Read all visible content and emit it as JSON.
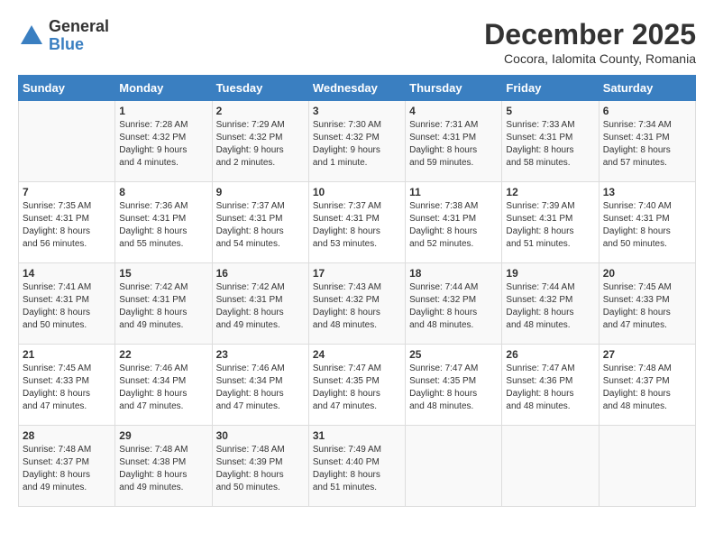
{
  "logo": {
    "general": "General",
    "blue": "Blue"
  },
  "title": "December 2025",
  "location": "Cocora, Ialomita County, Romania",
  "weekdays": [
    "Sunday",
    "Monday",
    "Tuesday",
    "Wednesday",
    "Thursday",
    "Friday",
    "Saturday"
  ],
  "weeks": [
    [
      {
        "day": "",
        "content": ""
      },
      {
        "day": "1",
        "content": "Sunrise: 7:28 AM\nSunset: 4:32 PM\nDaylight: 9 hours\nand 4 minutes."
      },
      {
        "day": "2",
        "content": "Sunrise: 7:29 AM\nSunset: 4:32 PM\nDaylight: 9 hours\nand 2 minutes."
      },
      {
        "day": "3",
        "content": "Sunrise: 7:30 AM\nSunset: 4:32 PM\nDaylight: 9 hours\nand 1 minute."
      },
      {
        "day": "4",
        "content": "Sunrise: 7:31 AM\nSunset: 4:31 PM\nDaylight: 8 hours\nand 59 minutes."
      },
      {
        "day": "5",
        "content": "Sunrise: 7:33 AM\nSunset: 4:31 PM\nDaylight: 8 hours\nand 58 minutes."
      },
      {
        "day": "6",
        "content": "Sunrise: 7:34 AM\nSunset: 4:31 PM\nDaylight: 8 hours\nand 57 minutes."
      }
    ],
    [
      {
        "day": "7",
        "content": "Sunrise: 7:35 AM\nSunset: 4:31 PM\nDaylight: 8 hours\nand 56 minutes."
      },
      {
        "day": "8",
        "content": "Sunrise: 7:36 AM\nSunset: 4:31 PM\nDaylight: 8 hours\nand 55 minutes."
      },
      {
        "day": "9",
        "content": "Sunrise: 7:37 AM\nSunset: 4:31 PM\nDaylight: 8 hours\nand 54 minutes."
      },
      {
        "day": "10",
        "content": "Sunrise: 7:37 AM\nSunset: 4:31 PM\nDaylight: 8 hours\nand 53 minutes."
      },
      {
        "day": "11",
        "content": "Sunrise: 7:38 AM\nSunset: 4:31 PM\nDaylight: 8 hours\nand 52 minutes."
      },
      {
        "day": "12",
        "content": "Sunrise: 7:39 AM\nSunset: 4:31 PM\nDaylight: 8 hours\nand 51 minutes."
      },
      {
        "day": "13",
        "content": "Sunrise: 7:40 AM\nSunset: 4:31 PM\nDaylight: 8 hours\nand 50 minutes."
      }
    ],
    [
      {
        "day": "14",
        "content": "Sunrise: 7:41 AM\nSunset: 4:31 PM\nDaylight: 8 hours\nand 50 minutes."
      },
      {
        "day": "15",
        "content": "Sunrise: 7:42 AM\nSunset: 4:31 PM\nDaylight: 8 hours\nand 49 minutes."
      },
      {
        "day": "16",
        "content": "Sunrise: 7:42 AM\nSunset: 4:31 PM\nDaylight: 8 hours\nand 49 minutes."
      },
      {
        "day": "17",
        "content": "Sunrise: 7:43 AM\nSunset: 4:32 PM\nDaylight: 8 hours\nand 48 minutes."
      },
      {
        "day": "18",
        "content": "Sunrise: 7:44 AM\nSunset: 4:32 PM\nDaylight: 8 hours\nand 48 minutes."
      },
      {
        "day": "19",
        "content": "Sunrise: 7:44 AM\nSunset: 4:32 PM\nDaylight: 8 hours\nand 48 minutes."
      },
      {
        "day": "20",
        "content": "Sunrise: 7:45 AM\nSunset: 4:33 PM\nDaylight: 8 hours\nand 47 minutes."
      }
    ],
    [
      {
        "day": "21",
        "content": "Sunrise: 7:45 AM\nSunset: 4:33 PM\nDaylight: 8 hours\nand 47 minutes."
      },
      {
        "day": "22",
        "content": "Sunrise: 7:46 AM\nSunset: 4:34 PM\nDaylight: 8 hours\nand 47 minutes."
      },
      {
        "day": "23",
        "content": "Sunrise: 7:46 AM\nSunset: 4:34 PM\nDaylight: 8 hours\nand 47 minutes."
      },
      {
        "day": "24",
        "content": "Sunrise: 7:47 AM\nSunset: 4:35 PM\nDaylight: 8 hours\nand 47 minutes."
      },
      {
        "day": "25",
        "content": "Sunrise: 7:47 AM\nSunset: 4:35 PM\nDaylight: 8 hours\nand 48 minutes."
      },
      {
        "day": "26",
        "content": "Sunrise: 7:47 AM\nSunset: 4:36 PM\nDaylight: 8 hours\nand 48 minutes."
      },
      {
        "day": "27",
        "content": "Sunrise: 7:48 AM\nSunset: 4:37 PM\nDaylight: 8 hours\nand 48 minutes."
      }
    ],
    [
      {
        "day": "28",
        "content": "Sunrise: 7:48 AM\nSunset: 4:37 PM\nDaylight: 8 hours\nand 49 minutes."
      },
      {
        "day": "29",
        "content": "Sunrise: 7:48 AM\nSunset: 4:38 PM\nDaylight: 8 hours\nand 49 minutes."
      },
      {
        "day": "30",
        "content": "Sunrise: 7:48 AM\nSunset: 4:39 PM\nDaylight: 8 hours\nand 50 minutes."
      },
      {
        "day": "31",
        "content": "Sunrise: 7:49 AM\nSunset: 4:40 PM\nDaylight: 8 hours\nand 51 minutes."
      },
      {
        "day": "",
        "content": ""
      },
      {
        "day": "",
        "content": ""
      },
      {
        "day": "",
        "content": ""
      }
    ]
  ]
}
